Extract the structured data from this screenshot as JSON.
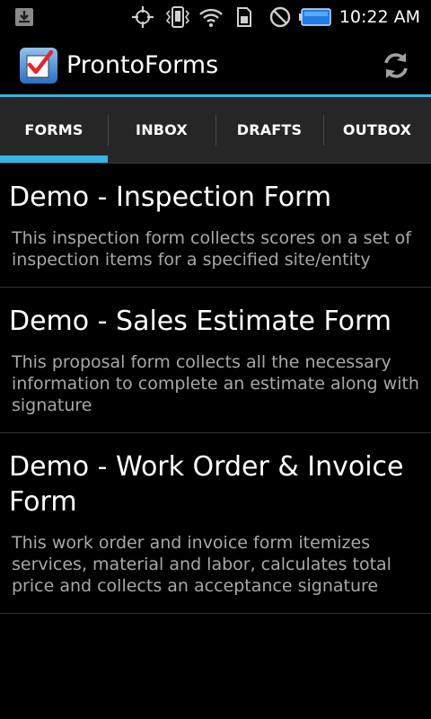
{
  "status_bar": {
    "time": "10:22 AM",
    "icons": [
      "download-icon",
      "gps-icon",
      "vibrate-icon",
      "wifi-icon",
      "sim-icon",
      "no-signal-icon",
      "battery-icon"
    ]
  },
  "app": {
    "title": "ProntoForms",
    "logo_icon": "checkbox-logo-icon",
    "refresh_icon": "refresh-icon"
  },
  "tabs": [
    {
      "label": "FORMS",
      "active": true
    },
    {
      "label": "INBOX",
      "active": false
    },
    {
      "label": "DRAFTS",
      "active": false
    },
    {
      "label": "OUTBOX",
      "active": false
    }
  ],
  "forms": [
    {
      "title": "Demo - Inspection Form",
      "description": "This inspection form collects scores on a set of inspection items for a specified site/entity"
    },
    {
      "title": "Demo - Sales Estimate Form",
      "description": "This proposal form collects all the necessary information to complete an estimate along with signature"
    },
    {
      "title": "Demo - Work Order & Invoice Form",
      "description": "This work order and invoice form itemizes services, material and labor, calculates total price and collects an acceptance signature"
    }
  ],
  "colors": {
    "accent": "#33b5e5",
    "tab_background": "#262626",
    "background": "#000000",
    "secondary_text": "#a8a8a8"
  }
}
